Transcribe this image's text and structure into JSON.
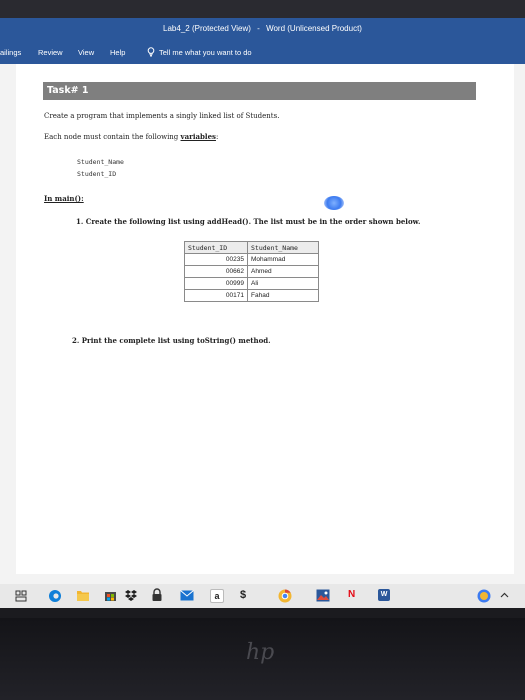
{
  "window": {
    "document_name": "Lab4_2 (Protected View)",
    "separator": "-",
    "app_name": "Word (Unlicensed Product)"
  },
  "ribbon": {
    "tabs": [
      "ailings",
      "Review",
      "View",
      "Help"
    ],
    "tell_me": "Tell me what you want to do"
  },
  "document": {
    "task_header": "Task# 1",
    "intro": "Create a program that implements a singly linked list of Students.",
    "variables_prefix": "Each node must contain the following ",
    "variables_word": "variables",
    "variables_suffix": ":",
    "variables": [
      "Student_Name",
      "Student_ID"
    ],
    "in_main": "In main():",
    "step1": "1.  Create the following list using addHead(). The list must be in the order shown below.",
    "table": {
      "headers": [
        "Student_ID",
        "Student_Name"
      ],
      "rows": [
        [
          "00235",
          "Mohammad"
        ],
        [
          "00662",
          "Ahmed"
        ],
        [
          "00999",
          "Ali"
        ],
        [
          "00171",
          "Fahad"
        ]
      ]
    },
    "step2": "2.  Print the complete list using toString() method."
  },
  "taskbar": {
    "icons": [
      "task-view-icon",
      "edge-icon",
      "file-explorer-icon",
      "store-icon",
      "dropbox-icon",
      "lock-icon",
      "mail-icon",
      "amazon-icon",
      "money-icon",
      "chrome-icon",
      "photos-icon",
      "netflix-icon",
      "word-icon",
      "help-icon",
      "chevron-up-icon"
    ],
    "amazon_letter": "a",
    "netflix_letter": "N",
    "word_letter": "W",
    "accent": "#2b579a"
  },
  "bezel": {
    "logo": "hp"
  }
}
